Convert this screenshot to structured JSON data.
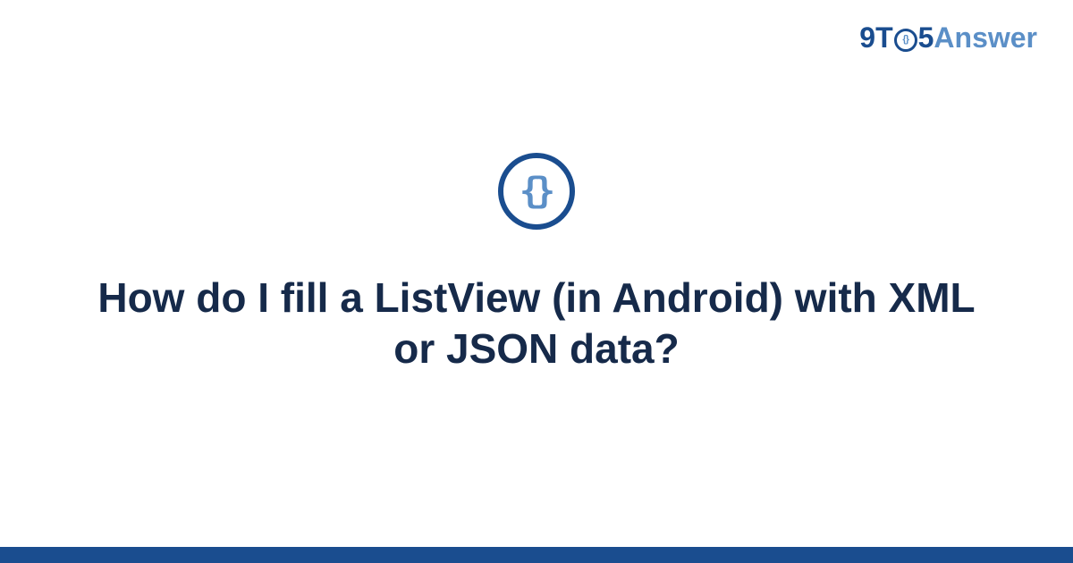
{
  "brand": {
    "part1": "9T",
    "inner_code": "{}",
    "part2_prefix": "5",
    "part2_word": "Answer"
  },
  "category": {
    "icon_glyph": "{}",
    "name": "json"
  },
  "question": {
    "title": "How do I fill a ListView (in Android) with XML or JSON data?"
  },
  "colors": {
    "primary_dark": "#1a4d8f",
    "primary_light": "#5b8fc7",
    "text_dark": "#162a4a"
  }
}
